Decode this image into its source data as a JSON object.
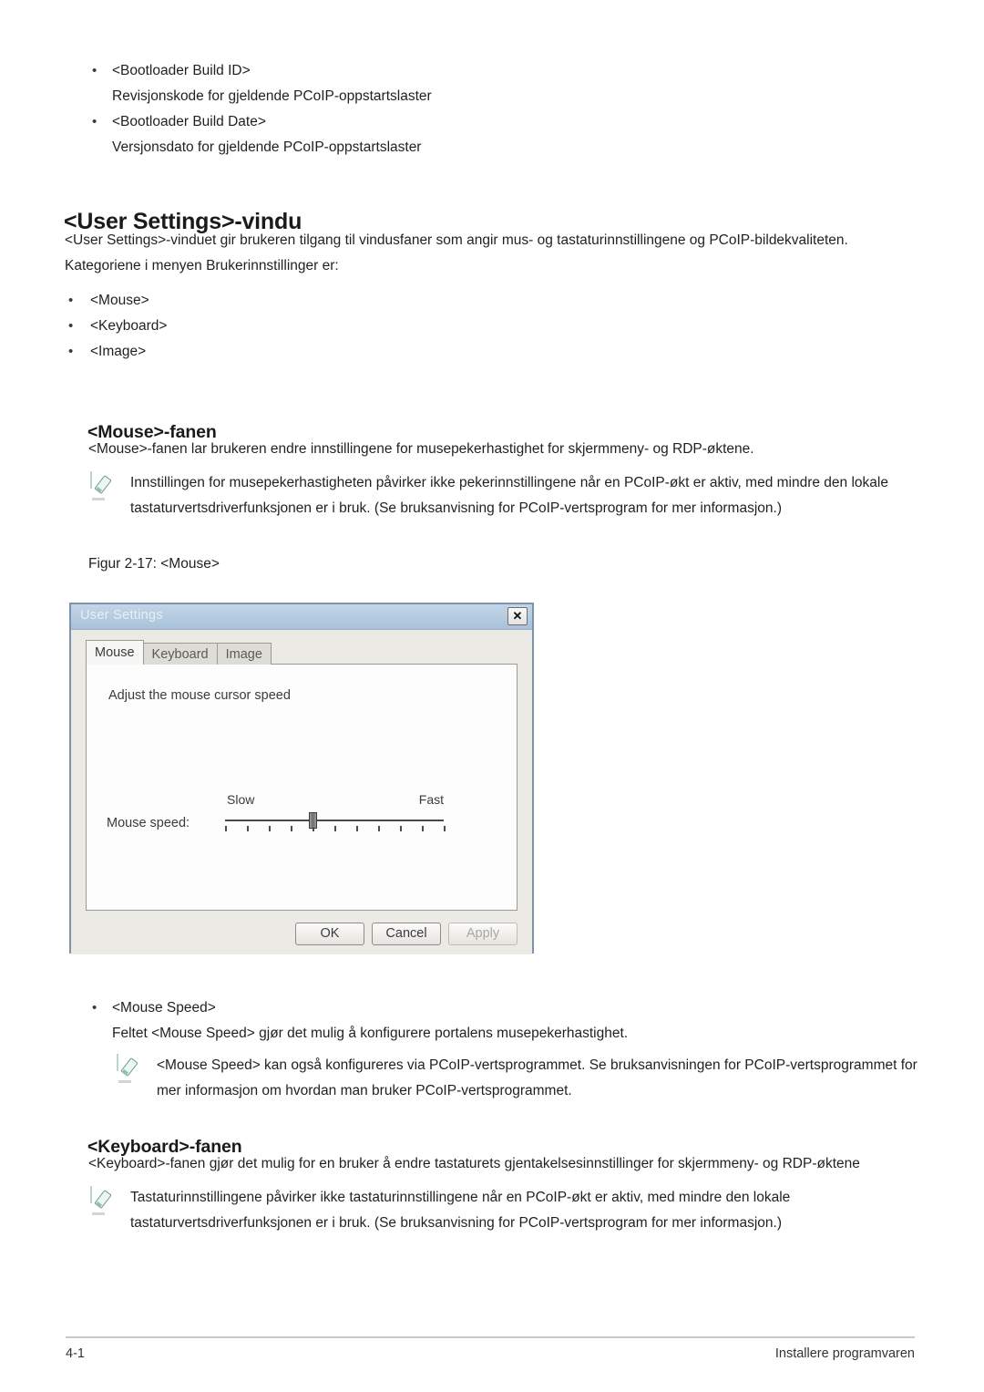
{
  "top_bullets": [
    {
      "term": "<Bootloader Build ID>",
      "desc": "Revisjonskode for gjeldende PCoIP-oppstartslaster"
    },
    {
      "term": "<Bootloader Build Date>",
      "desc": "Versjonsdato for gjeldende PCoIP-oppstartslaster"
    }
  ],
  "section": {
    "heading": "<User Settings>-vindu",
    "intro": "<User Settings>-vinduet gir brukeren tilgang til vindusfaner som angir mus- og tastaturinnstillingene og PCoIP-bildekvaliteten.",
    "intro2": "Kategoriene i menyen Brukerinnstillinger er:",
    "categories": [
      "<Mouse>",
      "<Keyboard>",
      "<Image>"
    ]
  },
  "mouse_tab": {
    "heading": "<Mouse>-fanen",
    "paragraph": "<Mouse>-fanen lar brukeren endre innstillingene for musepekerhastighet for skjermmeny- og RDP-øktene.",
    "note": "Innstillingen for musepekerhastigheten påvirker ikke pekerinnstillingene når en PCoIP-økt er aktiv, med mindre den lokale tastaturvertsdriverfunksjonen er i bruk. (Se bruksanvisning for PCoIP-vertsprogram for mer informasjon.)",
    "figure_caption": "Figur 2-17: <Mouse>"
  },
  "dialog": {
    "title": "User Settings",
    "close_label": "✕",
    "tabs": [
      {
        "label": "Mouse",
        "active": true
      },
      {
        "label": "Keyboard",
        "active": false
      },
      {
        "label": "Image",
        "active": false
      }
    ],
    "panel_heading": "Adjust the mouse cursor speed",
    "slider": {
      "label": "Mouse speed:",
      "min_label": "Slow",
      "max_label": "Fast",
      "ticks": 11,
      "value_index": 4
    },
    "buttons": [
      {
        "label": "OK",
        "disabled": false
      },
      {
        "label": "Cancel",
        "disabled": false
      },
      {
        "label": "Apply",
        "disabled": true
      }
    ]
  },
  "mouse_speed": {
    "term": "<Mouse Speed>",
    "desc": "Feltet <Mouse Speed> gjør det mulig å konfigurere portalens musepekerhastighet.",
    "note": "<Mouse Speed> kan også konfigureres via PCoIP-vertsprogrammet. Se bruksanvisningen for PCoIP-vertsprogrammet for mer informasjon om hvordan man bruker PCoIP-vertsprogrammet."
  },
  "keyboard_tab": {
    "heading": "<Keyboard>-fanen",
    "paragraph": "<Keyboard>-fanen gjør det mulig for en bruker å endre tastaturets gjentakelsesinnstillinger for skjermmeny- og RDP-øktene",
    "note": "Tastaturinnstillingene påvirker ikke tastaturinnstillingene når en PCoIP-økt er aktiv, med mindre den lokale tastaturvertsdriverfunksjonen er i bruk. (Se bruksanvisning for PCoIP-vertsprogram for mer informasjon.)"
  },
  "footer": {
    "page_number": "4-1",
    "section_name": "Installere programvaren"
  },
  "bullet_glyph": "•",
  "colors": {
    "note_icon_bg": "#8fbeb2",
    "dialog_titlebar": "#b5cbdf",
    "dialog_border": "#7d93ad"
  }
}
